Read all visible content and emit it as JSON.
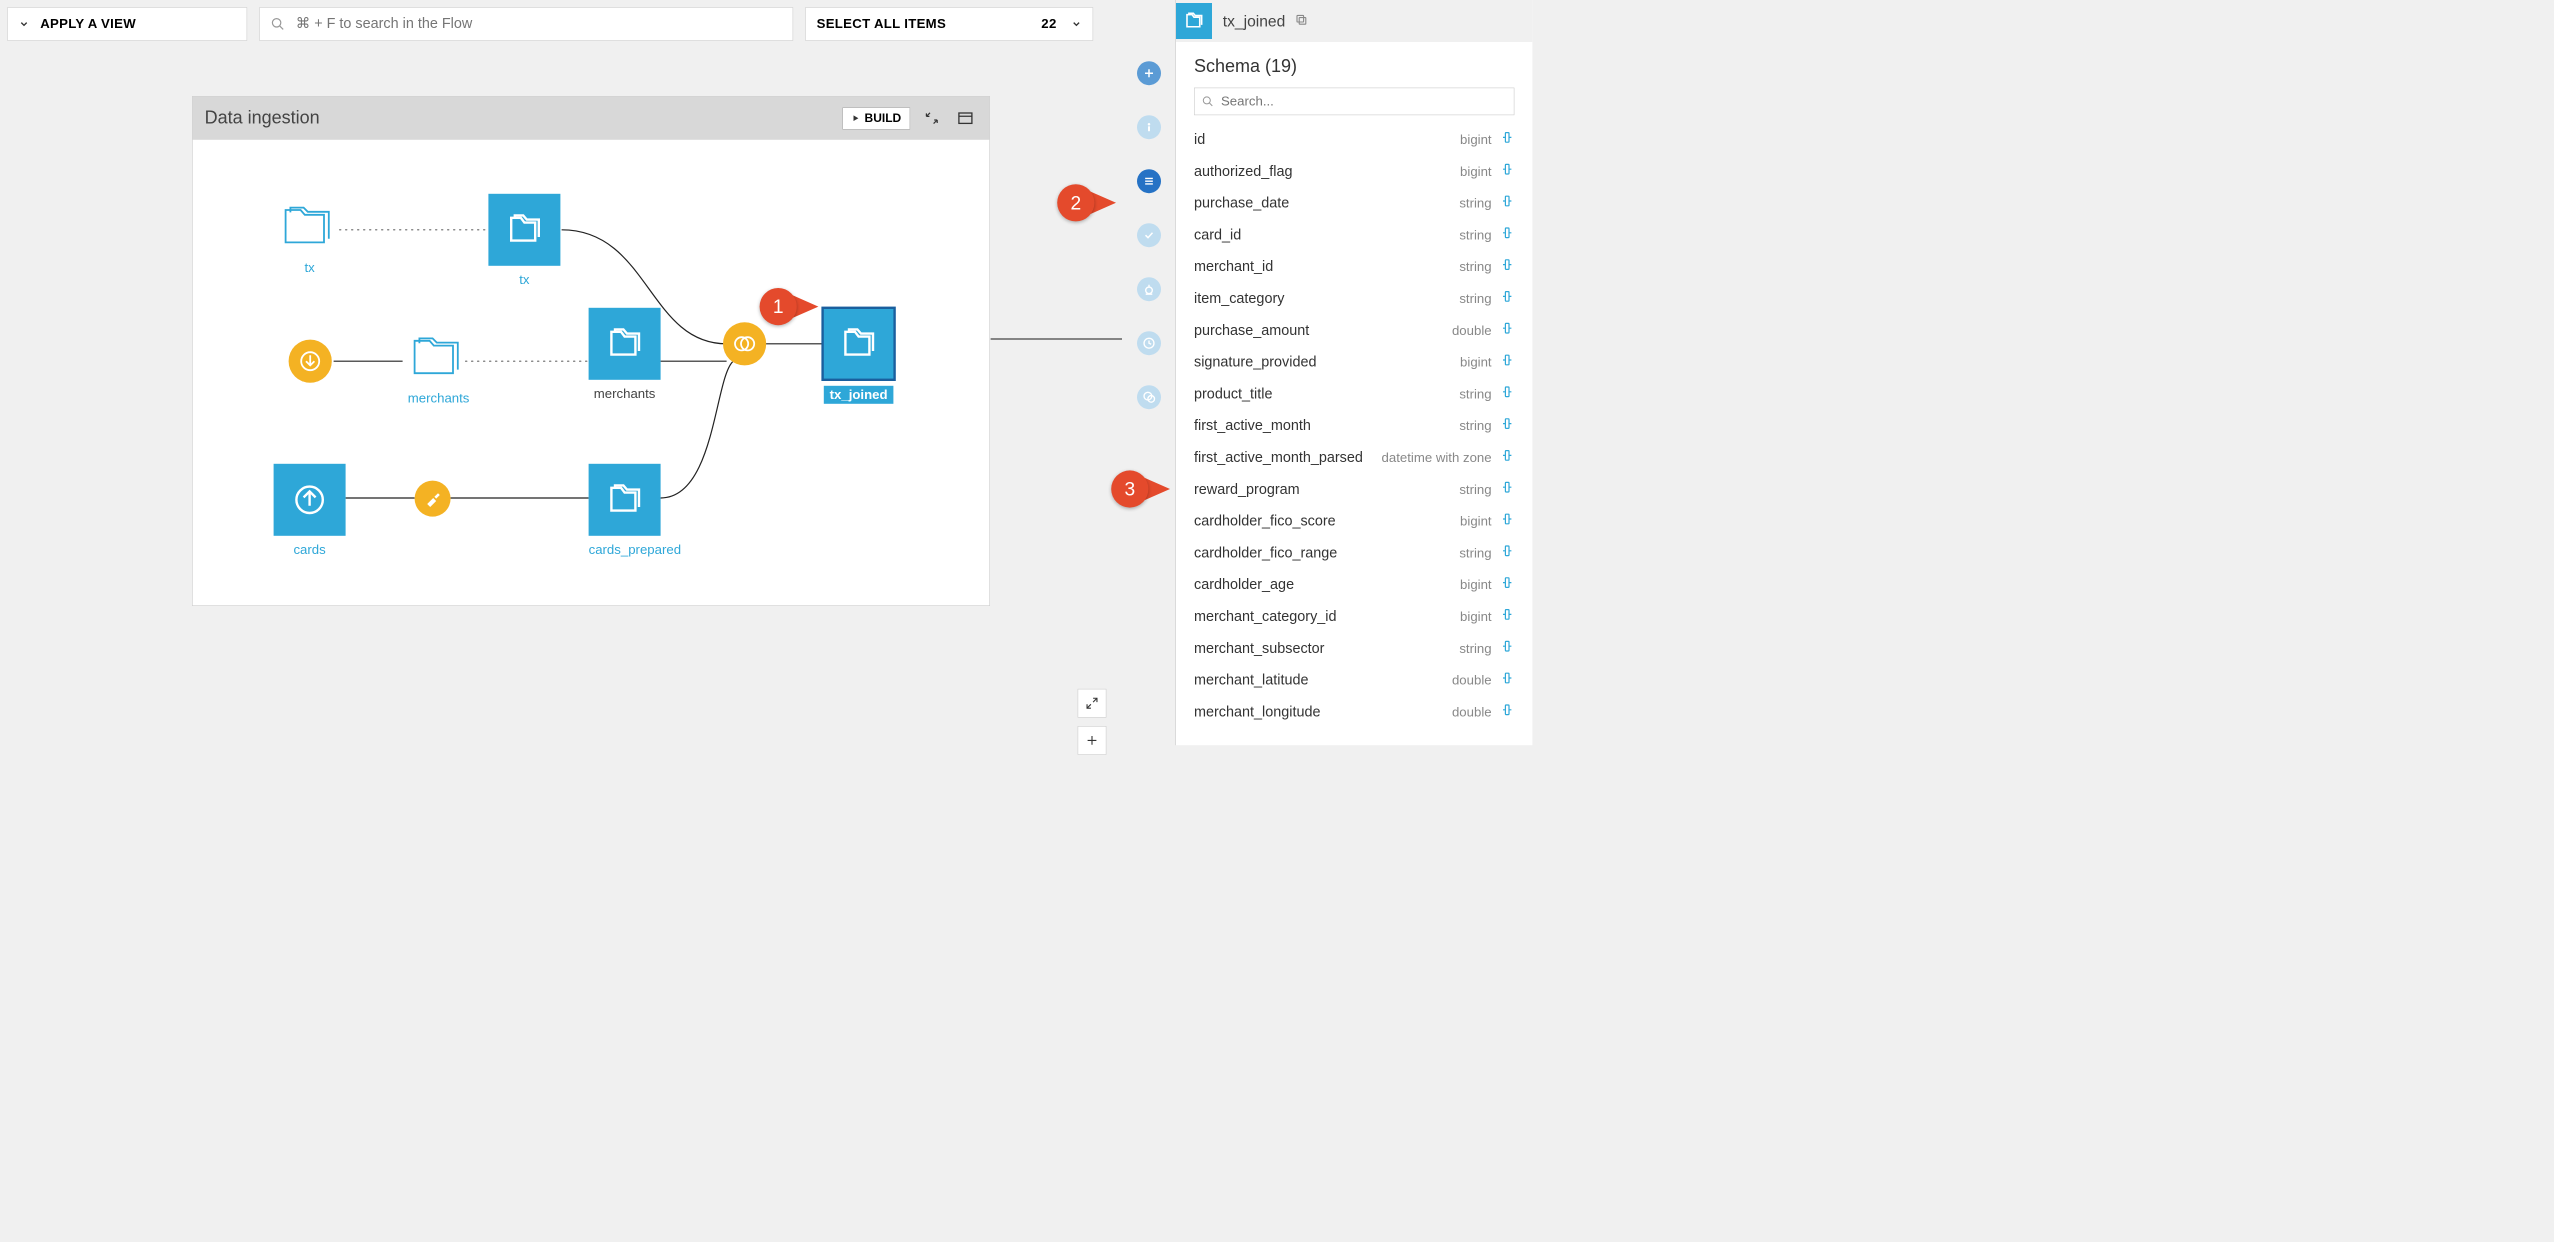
{
  "toolbar": {
    "apply_view_label": "APPLY A VIEW",
    "search_placeholder": "⌘ + F to search in the Flow",
    "select_all_label": "SELECT ALL ITEMS",
    "select_all_count": "22"
  },
  "zone": {
    "title": "Data ingestion",
    "build_label": "BUILD"
  },
  "nodes": {
    "tx_folder": "tx",
    "tx_dataset": "tx",
    "merchants_folder": "merchants",
    "merchants_dataset": "merchants",
    "cards_dataset": "cards",
    "cards_prepared": "cards_prepared",
    "tx_joined": "tx_joined"
  },
  "callouts": {
    "c1": "1",
    "c2": "2",
    "c3": "3"
  },
  "panel": {
    "title": "tx_joined",
    "schema_title": "Schema (19)",
    "schema_search_placeholder": "Search...",
    "columns": [
      {
        "name": "id",
        "type": "bigint"
      },
      {
        "name": "authorized_flag",
        "type": "bigint"
      },
      {
        "name": "purchase_date",
        "type": "string"
      },
      {
        "name": "card_id",
        "type": "string"
      },
      {
        "name": "merchant_id",
        "type": "string"
      },
      {
        "name": "item_category",
        "type": "string"
      },
      {
        "name": "purchase_amount",
        "type": "double"
      },
      {
        "name": "signature_provided",
        "type": "bigint"
      },
      {
        "name": "product_title",
        "type": "string"
      },
      {
        "name": "first_active_month",
        "type": "string"
      },
      {
        "name": "first_active_month_parsed",
        "type": "datetime with zone"
      },
      {
        "name": "reward_program",
        "type": "string"
      },
      {
        "name": "cardholder_fico_score",
        "type": "bigint"
      },
      {
        "name": "cardholder_fico_range",
        "type": "string"
      },
      {
        "name": "cardholder_age",
        "type": "bigint"
      },
      {
        "name": "merchant_category_id",
        "type": "bigint"
      },
      {
        "name": "merchant_subsector",
        "type": "string"
      },
      {
        "name": "merchant_latitude",
        "type": "double"
      },
      {
        "name": "merchant_longitude",
        "type": "double"
      }
    ]
  }
}
